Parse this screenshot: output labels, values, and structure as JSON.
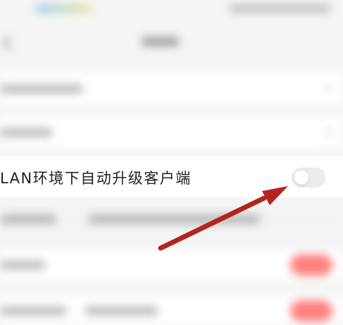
{
  "settings": {
    "auto_upgrade_wlan_label": "LAN环境下自动升级客户端",
    "auto_upgrade_wlan_enabled": false
  },
  "annotation": {
    "arrow_color": "#b3251f",
    "arrow_target": "auto-upgrade-toggle"
  },
  "colors": {
    "background": "#f5f5f5",
    "toggle_off": "#ececec",
    "blurred_toggle_on": "#ff6b6b"
  },
  "icons": {
    "back": "chevron-left-icon",
    "row_chevron": "chevron-right-icon"
  }
}
